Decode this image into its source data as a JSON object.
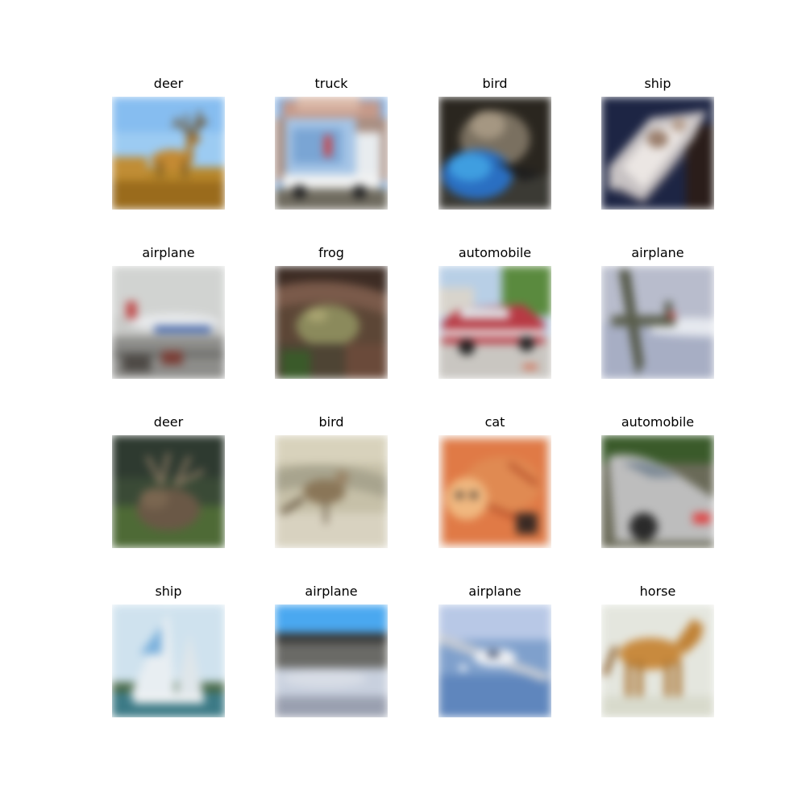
{
  "grid": {
    "items": [
      {
        "label": "deer"
      },
      {
        "label": "truck"
      },
      {
        "label": "bird"
      },
      {
        "label": "ship"
      },
      {
        "label": "airplane"
      },
      {
        "label": "frog"
      },
      {
        "label": "automobile"
      },
      {
        "label": "airplane"
      },
      {
        "label": "deer"
      },
      {
        "label": "bird"
      },
      {
        "label": "cat"
      },
      {
        "label": "automobile"
      },
      {
        "label": "ship"
      },
      {
        "label": "airplane"
      },
      {
        "label": "airplane"
      },
      {
        "label": "horse"
      }
    ]
  }
}
